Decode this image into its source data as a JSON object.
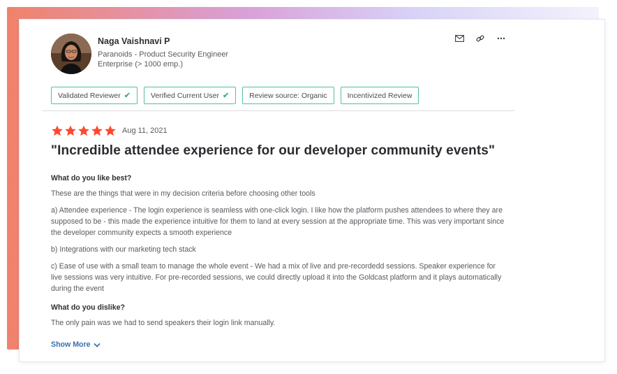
{
  "reviewer": {
    "name": "Naga Vaishnavi P",
    "title": "Paranoids - Product Security Engineer",
    "company_size": "Enterprise (> 1000 emp.)"
  },
  "actions": {
    "icons": [
      "mail-icon",
      "link-icon",
      "more-icon"
    ],
    "more_label": "···"
  },
  "badges": [
    {
      "label": "Validated Reviewer",
      "checked": true
    },
    {
      "label": "Verified Current User",
      "checked": true
    },
    {
      "label": "Review source: Organic",
      "checked": false
    },
    {
      "label": "Incentivized Review",
      "checked": false
    }
  ],
  "badge_check": "✔",
  "rating": {
    "stars": 5,
    "date": "Aug 11, 2021",
    "star_color": "#ff492c"
  },
  "review": {
    "title": "\"Incredible attendee experience for our developer community events\"",
    "like_heading": "What do you like best?",
    "like_paragraphs": [
      "These are the things that were in my decision criteria before choosing other tools",
      "a) Attendee experience - The login experience is seamless with one-click login. I like how the platform pushes attendees to where they are supposed to be - this made the experience intuitive for them to land at every session at the appropriate time. This was very important since the developer community expects a smooth experience",
      "b) Integrations with our marketing tech stack",
      "c) Ease of use with a small team to manage the whole event - We had a mix of live and pre-recordedd sessions. Speaker experience for live sessions was very intuitive. For pre-recorded sessions, we could directly upload it into the Goldcast platform and it plays automatically during the event"
    ],
    "dislike_heading": "What do you dislike?",
    "dislike_paragraph": "The only pain was we had to send speakers their login link manually."
  },
  "show_more": {
    "label": "Show More",
    "color": "#3a6fb0"
  },
  "colors": {
    "badge_border": "#4fc1a5",
    "check": "#3bb28f"
  }
}
